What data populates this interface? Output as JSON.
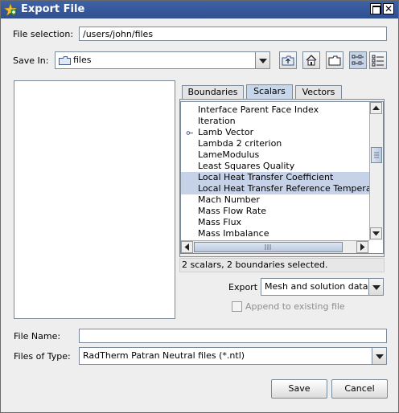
{
  "window": {
    "title": "Export File"
  },
  "file_selection": {
    "label": "File selection:",
    "value": "/users/john/files"
  },
  "save_in": {
    "label": "Save In:",
    "value": "files"
  },
  "toolbar": {
    "up_folder": "up-one-level-icon",
    "home": "home-icon",
    "new_folder": "new-folder-icon",
    "list_view": "list-view-icon",
    "details_view": "details-view-icon"
  },
  "tabs": [
    {
      "label": "Boundaries",
      "active": false
    },
    {
      "label": "Scalars",
      "active": true
    },
    {
      "label": "Vectors",
      "active": false
    }
  ],
  "scalars": [
    {
      "label": "Interface Parent Face Index",
      "selected": false,
      "vector": false
    },
    {
      "label": "Iteration",
      "selected": false,
      "vector": false
    },
    {
      "label": "Lamb Vector",
      "selected": false,
      "vector": true
    },
    {
      "label": "Lambda 2 criterion",
      "selected": false,
      "vector": false
    },
    {
      "label": "LameModulus",
      "selected": false,
      "vector": false
    },
    {
      "label": "Least Squares Quality",
      "selected": false,
      "vector": false
    },
    {
      "label": "Local Heat Transfer Coefficient",
      "selected": true,
      "vector": false
    },
    {
      "label": "Local Heat Transfer Reference Temperature",
      "selected": true,
      "vector": false
    },
    {
      "label": "Mach Number",
      "selected": false,
      "vector": false
    },
    {
      "label": "Mass Flow Rate",
      "selected": false,
      "vector": false
    },
    {
      "label": "Mass Flux",
      "selected": false,
      "vector": false
    },
    {
      "label": "Mass Imbalance",
      "selected": false,
      "vector": false
    }
  ],
  "status_text": "2 scalars, 2 boundaries selected.",
  "export": {
    "label": "Export",
    "value": "Mesh and solution data"
  },
  "append": {
    "label": "Append to existing file",
    "checked": false,
    "enabled": false
  },
  "file_name": {
    "label": "File Name:",
    "value": ""
  },
  "files_of_type": {
    "label": "Files of Type:",
    "value": "RadTherm Patran Neutral files (*.ntl)"
  },
  "buttons": {
    "save": "Save",
    "cancel": "Cancel"
  },
  "colors": {
    "titlebar": "#2f4f8f",
    "selection": "#c5d2e8",
    "active_tab": "#c8d6ea"
  }
}
